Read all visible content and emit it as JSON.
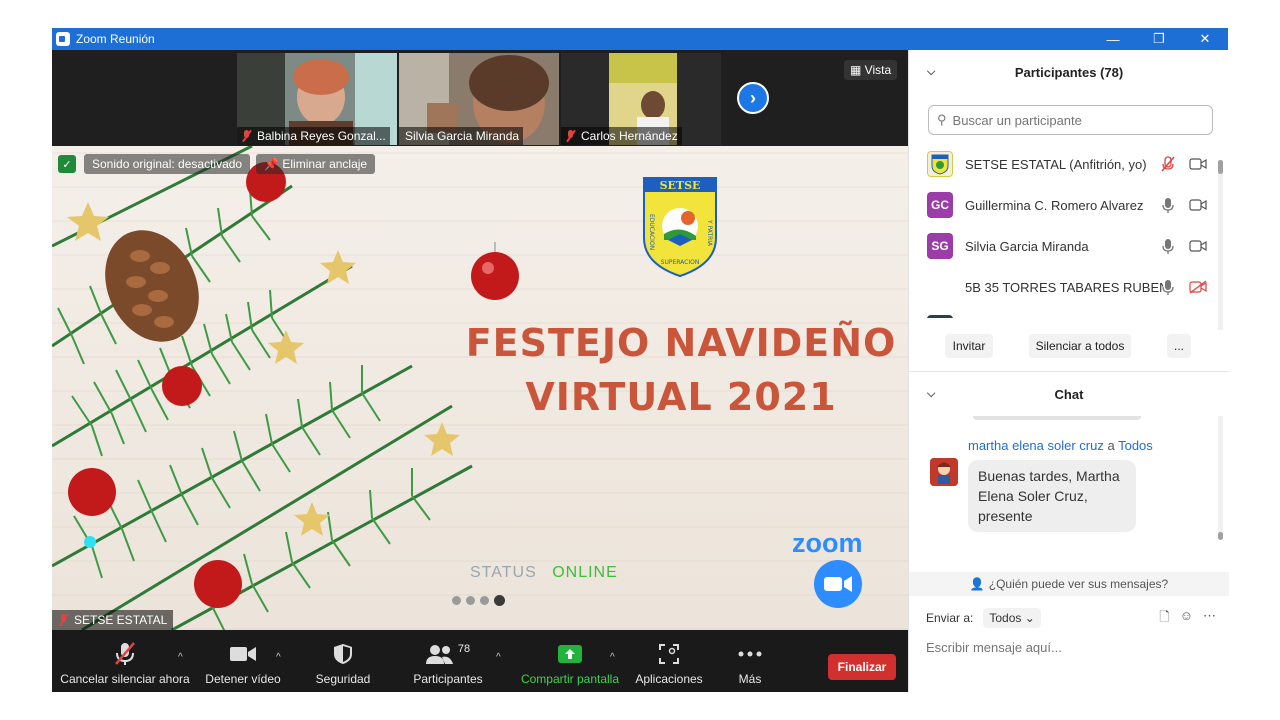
{
  "window": {
    "title": "Zoom Reunión",
    "minimize": "—",
    "restore": "❐",
    "close": "✕"
  },
  "thumbnails": [
    {
      "name": "Balbina Reyes Gonzal..."
    },
    {
      "name": "Silvia Garcia Miranda"
    },
    {
      "name": "Carlos Hernández"
    }
  ],
  "view_button": "Vista",
  "stage": {
    "original_sound": "Sonido original: desactivado",
    "unpin": "Eliminar anclaje",
    "logo_text": "SETSE",
    "logo_left": "EDUCACION",
    "logo_right": "Y PATRIA",
    "logo_bottom": "SUPERACION",
    "title_line1": "FESTEJO NAVIDEÑO",
    "title_line2": "VIRTUAL 2021",
    "status_label": "STATUS",
    "status_value": "ONLINE",
    "zoom_word": "zoom",
    "presenter": "SETSE ESTATAL",
    "colors": {
      "title": "#c9563a",
      "online": "#3bbf3b",
      "zoom": "#2d8cff"
    }
  },
  "toolbar": {
    "mute": "Cancelar silenciar ahora",
    "video": "Detener vídeo",
    "security": "Seguridad",
    "participants": "Participantes",
    "participants_count": "78",
    "share": "Compartir pantalla",
    "apps": "Aplicaciones",
    "more": "Más",
    "end": "Finalizar"
  },
  "participants_panel": {
    "header": "Participantes (78)",
    "search_placeholder": "Buscar un participante",
    "rows": [
      {
        "initials": "",
        "name": "SETSE ESTATAL (Anfitrión, yo)"
      },
      {
        "initials": "GC",
        "name": "Guillermina C. Romero Alvarez"
      },
      {
        "initials": "SG",
        "name": "Silvia Garcia Miranda"
      },
      {
        "initials": "",
        "name": "5B 35 TORRES TABARES RUBEN ..."
      }
    ],
    "invite": "Invitar",
    "mute_all": "Silenciar a todos",
    "more": "..."
  },
  "chat": {
    "header": "Chat",
    "from": "martha elena soler cruz",
    "to_word": "a",
    "to": "Todos",
    "message": "Buenas tardes, Martha Elena Soler Cruz, presente",
    "who_sees": "¿Quién puede ver sus mensajes?",
    "send_to_label": "Enviar a:",
    "send_to_value": "Todos",
    "input_placeholder": "Escribir mensaje aquí..."
  }
}
